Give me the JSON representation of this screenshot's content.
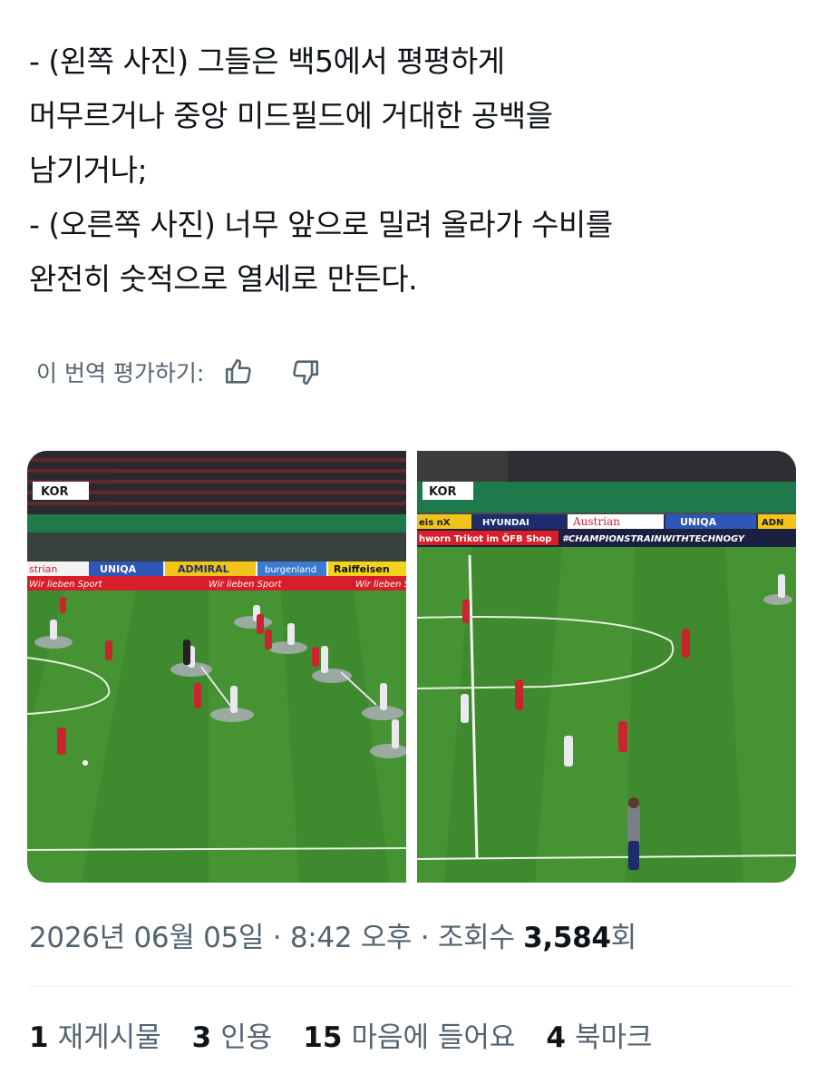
{
  "tweet": {
    "text": "- (왼쪽 사진) 그들은 백5에서 평평하게\n머무르거나 중앙 미드필드에 거대한 공백을\n남기거나;\n- (오른쪽 사진) 너무 앞으로 밀려 올라가 수비를\n완전히 숫적으로 열세로 만든다."
  },
  "translation_rating": {
    "label": "이 번역 평가하기:"
  },
  "media": {
    "left": {
      "score_tag": "KOR",
      "ad_boards": [
        "strian",
        "UNIQA",
        "ADMIRAL",
        "burgenland",
        "Raiffeisen",
        "Wir lieben Sport",
        "Wir lieben Sport",
        "Wir lieben Sp"
      ]
    },
    "right": {
      "score_tag": "KOR",
      "ad_boards": [
        "eis   nX",
        "HYUNDAI",
        "Austrian",
        "UNIQA",
        "ADN"
      ],
      "banner_left": "hworn Trikot im ÖFB Shop",
      "banner_right": "#CHAMPIONSTRAINWITHTECHNOGY"
    }
  },
  "meta": {
    "date": "2026년 06월 05일",
    "sep1": " · ",
    "time": "8:42 오후",
    "sep2": " · ",
    "views_label": "조회수 ",
    "views": "3,584",
    "views_suffix": "회"
  },
  "stats": {
    "reposts_count": "1",
    "reposts_label": "재게시물",
    "quotes_count": "3",
    "quotes_label": "인용",
    "likes_count": "15",
    "likes_label": "마음에 들어요",
    "bookmarks_count": "4",
    "bookmarks_label": "북마크"
  },
  "colors": {
    "text": "#0f1419",
    "secondary": "#536471",
    "pitch": "#3f8a2e",
    "korea_red": "#c8252c",
    "divider": "#eff3f4"
  }
}
